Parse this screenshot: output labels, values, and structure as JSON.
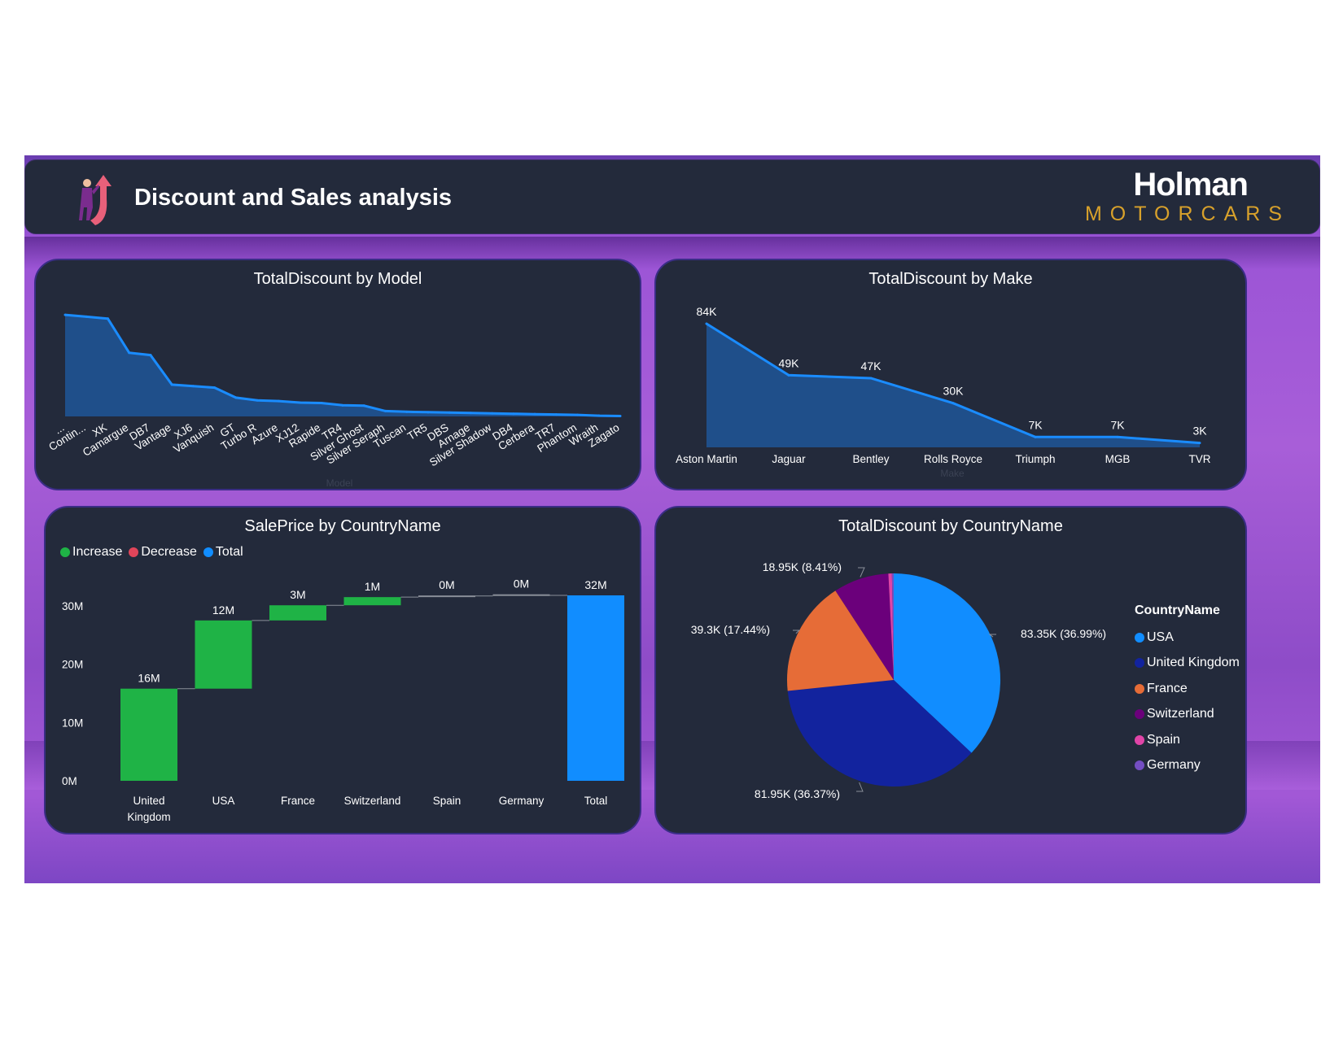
{
  "header": {
    "title": "Discount and Sales analysis",
    "brand_name": "Holman",
    "brand_sub": "MOTORCARS"
  },
  "colors": {
    "background_purple": "#a85ed8",
    "panel": "#232a3b",
    "line_blue": "#1a8cff",
    "area_blue": "#1f4f8a",
    "increase": "#1fb346",
    "decrease": "#e0455a",
    "total": "#118dff"
  },
  "panels": {
    "model": {
      "title": "TotalDiscount by Model",
      "xlabel": "Model"
    },
    "make": {
      "title": "TotalDiscount by Make",
      "xlabel": "Make"
    },
    "waterfall": {
      "title": "SalePrice by CountryName",
      "legend": [
        {
          "label": "Increase",
          "color": "#1fb346"
        },
        {
          "label": "Decrease",
          "color": "#e0455a"
        },
        {
          "label": "Total",
          "color": "#118dff"
        }
      ]
    },
    "pie": {
      "title": "TotalDiscount by CountryName",
      "legend_title": "CountryName"
    }
  },
  "chart_data": [
    {
      "type": "area",
      "title": "TotalDiscount by Model",
      "xlabel": "Model",
      "categories": [
        "...",
        "Contin...",
        "XK",
        "Camargue",
        "DB7",
        "Vantage",
        "XJ6",
        "Vanquish",
        "GT",
        "Turbo R",
        "Azure",
        "XJ12",
        "Rapide",
        "TR4",
        "Silver Ghost",
        "Silver Seraph",
        "Tuscan",
        "TR5",
        "DBS",
        "Arnage",
        "Silver Shadow",
        "DB4",
        "Cerbera",
        "TR7",
        "Phantom",
        "Wraith",
        "Zagato"
      ],
      "values": [
        26.5,
        26.0,
        25.5,
        16.6,
        16.0,
        8.3,
        7.9,
        7.5,
        4.9,
        4.2,
        4.0,
        3.6,
        3.5,
        2.9,
        2.8,
        1.4,
        1.2,
        1.1,
        1.0,
        0.9,
        0.8,
        0.7,
        0.6,
        0.5,
        0.4,
        0.2,
        0.1
      ],
      "ylim": [
        0,
        28
      ]
    },
    {
      "type": "area",
      "title": "TotalDiscount by Make",
      "xlabel": "Make",
      "categories": [
        "Aston Martin",
        "Jaguar",
        "Bentley",
        "Rolls Royce",
        "Triumph",
        "MGB",
        "TVR"
      ],
      "values": [
        84,
        49,
        47,
        30,
        7,
        7,
        3
      ],
      "data_labels": [
        "84K",
        "49K",
        "47K",
        "30K",
        "7K",
        "7K",
        "3K"
      ],
      "ylim": [
        0,
        90
      ]
    },
    {
      "type": "bar",
      "subtype": "waterfall",
      "title": "SalePrice by CountryName",
      "categories": [
        "United Kingdom",
        "USA",
        "France",
        "Switzerland",
        "Spain",
        "Germany",
        "Total"
      ],
      "values": [
        15.8,
        11.7,
        2.6,
        1.4,
        0.2,
        0.1,
        31.8
      ],
      "kinds": [
        "increase",
        "increase",
        "increase",
        "increase",
        "increase",
        "increase",
        "total"
      ],
      "data_labels": [
        "16M",
        "12M",
        "3M",
        "1M",
        "0M",
        "0M",
        "32M"
      ],
      "y_ticks": [
        "0M",
        "10M",
        "20M",
        "30M"
      ],
      "ylim": [
        0,
        32
      ]
    },
    {
      "type": "pie",
      "title": "TotalDiscount by CountryName",
      "legend_title": "CountryName",
      "slices": [
        {
          "label": "USA",
          "value": 83.35,
          "percent": 36.99,
          "color": "#118dff",
          "data_label": "83.35K (36.99%)"
        },
        {
          "label": "United Kingdom",
          "value": 81.95,
          "percent": 36.37,
          "color": "#12239e",
          "data_label": "81.95K (36.37%)"
        },
        {
          "label": "France",
          "value": 39.3,
          "percent": 17.44,
          "color": "#e66c37",
          "data_label": "39.3K (17.44%)"
        },
        {
          "label": "Switzerland",
          "value": 18.95,
          "percent": 8.41,
          "color": "#6b007b",
          "data_label": "18.95K (8.41%)"
        },
        {
          "label": "Spain",
          "value": 1.2,
          "percent": 0.53,
          "color": "#e044a7",
          "data_label": ""
        },
        {
          "label": "Germany",
          "value": 0.6,
          "percent": 0.26,
          "color": "#744ec2",
          "data_label": ""
        }
      ]
    }
  ]
}
